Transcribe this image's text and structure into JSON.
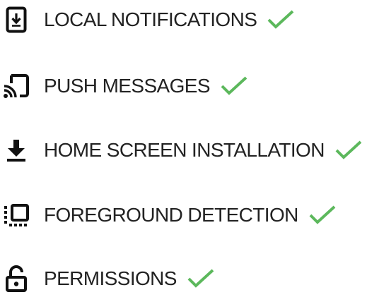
{
  "features": [
    {
      "label": "LOCAL NOTIFICATIONS",
      "icon": "phone-download-icon",
      "status": "check-icon"
    },
    {
      "label": "PUSH MESSAGES",
      "icon": "cast-icon",
      "status": "check-icon"
    },
    {
      "label": "HOME SCREEN INSTALLATION",
      "icon": "download-icon",
      "status": "check-icon"
    },
    {
      "label": "FOREGROUND DETECTION",
      "icon": "foreground-window-icon",
      "status": "check-icon"
    },
    {
      "label": "PERMISSIONS",
      "icon": "unlock-icon",
      "status": "check-icon"
    }
  ],
  "colors": {
    "text": "#222222",
    "icon": "#111111",
    "check": "#5cb85c",
    "background": "#ffffff"
  }
}
